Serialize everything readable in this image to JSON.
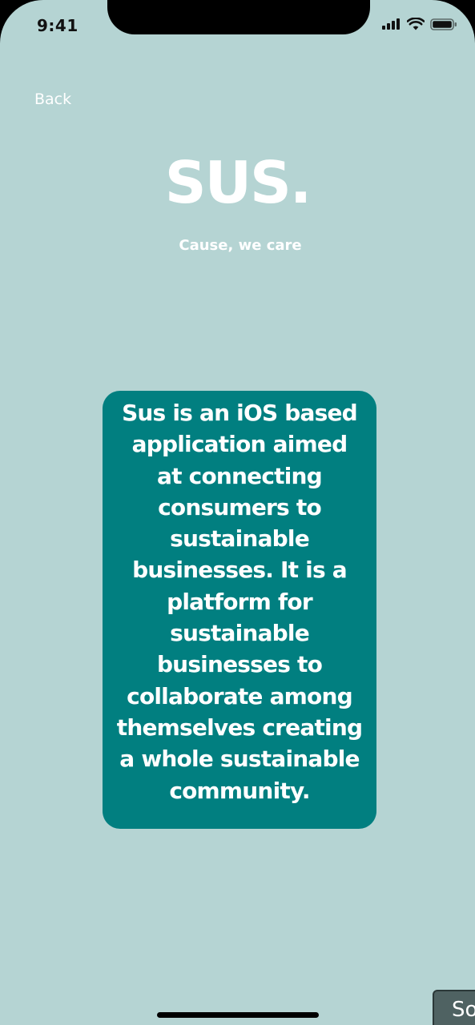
{
  "status_bar": {
    "time": "9:41",
    "icons": [
      "cellular-signal-icon",
      "wifi-icon",
      "battery-icon"
    ]
  },
  "nav": {
    "back_label": "Back"
  },
  "brand": {
    "logo": "SUS.",
    "tagline": "Cause, we care"
  },
  "about": {
    "text": "Sus is an iOS based\napplication aimed\nat connecting\nconsumers to\nsustainable\nbusinesses. It is a\nplatform for\nsustainable\nbusinesses to\ncollaborate among\nthemselves creating\na whole sustainable\ncommunity."
  },
  "corner_button": {
    "label": "So"
  },
  "colors": {
    "background": "#b5d4d3",
    "card": "#017f80",
    "text": "#ffffff"
  }
}
